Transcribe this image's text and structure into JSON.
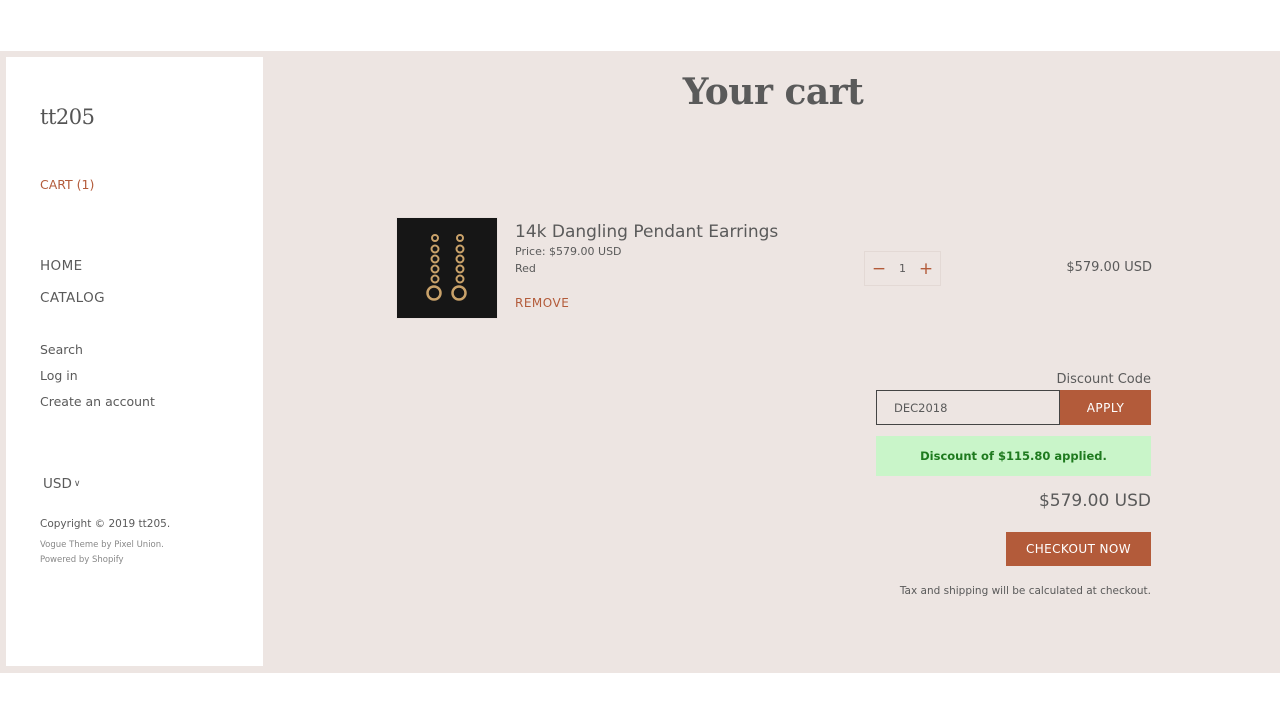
{
  "store": {
    "name": "tt205"
  },
  "sidebar": {
    "cart_label": "CART (1)",
    "main_nav": [
      {
        "label": "HOME"
      },
      {
        "label": "CATALOG"
      }
    ],
    "secondary_nav": [
      {
        "label": "Search"
      },
      {
        "label": "Log in"
      },
      {
        "label": "Create an account"
      }
    ],
    "currency": {
      "selected": "USD",
      "icon": "chevron-down-icon"
    },
    "footer": {
      "copyright": "Copyright © 2019 tt205.",
      "theme_credit": "Vogue Theme by Pixel Union.",
      "powered_by": "Powered by Shopify"
    }
  },
  "cart": {
    "title": "Your cart",
    "items": [
      {
        "title": "14k Dangling Pendant Earrings",
        "price": "Price: $579.00 USD",
        "variant": "Red",
        "remove_label": "REMOVE",
        "quantity": "1",
        "line_total": "$579.00 USD",
        "image": "gold-dangling-earrings-on-black"
      }
    ],
    "quantity_controls": {
      "decrease_icon": "minus-icon",
      "increase_icon": "plus-icon",
      "decrease_symbol": "−",
      "increase_symbol": "+"
    },
    "discount": {
      "label": "Discount Code",
      "value": "DEC2018",
      "apply_label": "APPLY",
      "message": "Discount of $115.80 applied."
    },
    "subtotal": "$579.00 USD",
    "checkout_label": "CHECKOUT NOW",
    "tax_note": "Tax and shipping will be calculated at checkout."
  },
  "colors": {
    "accent": "#b35b3a",
    "page_background": "#ede5e2",
    "success_background": "#c9f5c9",
    "success_text": "#1e7a1e",
    "text": "#5a5a5a"
  }
}
